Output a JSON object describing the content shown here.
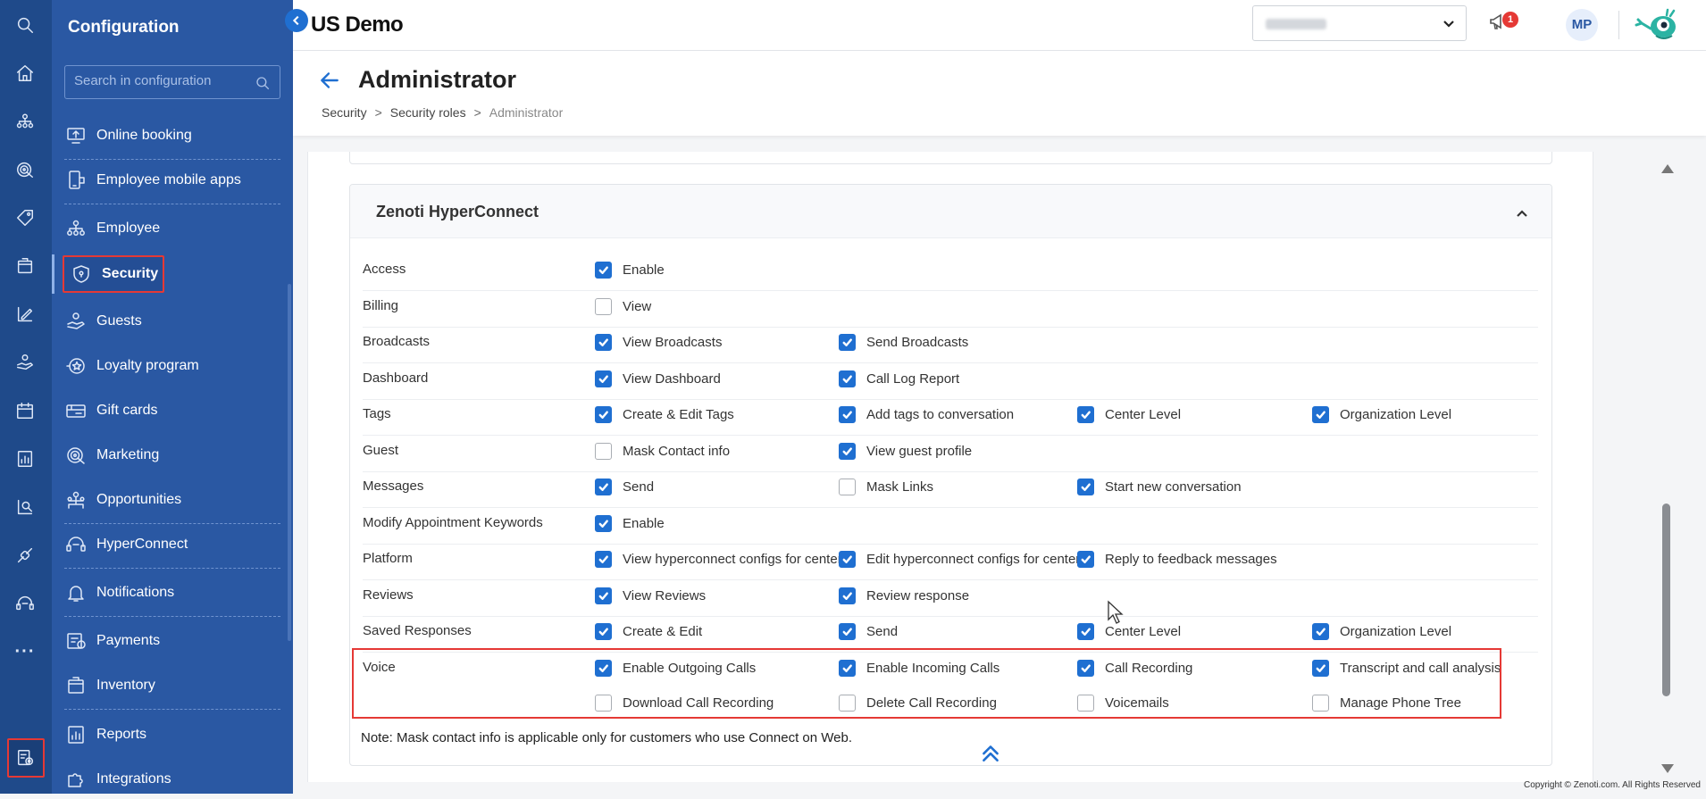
{
  "app": {
    "org_name": "US Demo",
    "avatar_initials": "MP",
    "notification_count": "1"
  },
  "iconbar": {
    "icons": [
      "search-icon",
      "home-icon",
      "org-chart-icon",
      "marketing-target-icon",
      "tag-icon",
      "package-icon",
      "analytics-pencil-icon",
      "guest-hand-icon",
      "calendar-icon",
      "reports-icon",
      "search-people-icon",
      "integrations-icon",
      "headset-icon",
      "more-icon",
      "configuration-icon"
    ]
  },
  "sidebar": {
    "title": "Configuration",
    "search_placeholder": "Search in configuration",
    "items": [
      {
        "label": "Online booking",
        "icon": "monitor-upload-icon"
      },
      {
        "label": "Employee mobile apps",
        "icon": "mobile-app-icon"
      },
      {
        "label": "Employee",
        "icon": "org-chart-icon"
      },
      {
        "label": "Security",
        "icon": "shield-icon"
      },
      {
        "label": "Guests",
        "icon": "guest-hand-icon"
      },
      {
        "label": "Loyalty program",
        "icon": "loyalty-star-icon"
      },
      {
        "label": "Gift cards",
        "icon": "gift-card-icon"
      },
      {
        "label": "Marketing",
        "icon": "marketing-target-icon"
      },
      {
        "label": "Opportunities",
        "icon": "opportunities-icon"
      },
      {
        "label": "HyperConnect",
        "icon": "headset-icon"
      },
      {
        "label": "Notifications",
        "icon": "bell-icon"
      },
      {
        "label": "Payments",
        "icon": "payment-icon"
      },
      {
        "label": "Inventory",
        "icon": "box-icon"
      },
      {
        "label": "Reports",
        "icon": "reports-icon"
      },
      {
        "label": "Integrations",
        "icon": "puzzle-icon"
      }
    ]
  },
  "page": {
    "title": "Administrator",
    "breadcrumb": [
      "Security",
      "Security roles",
      "Administrator"
    ]
  },
  "section": {
    "title": "Zenoti HyperConnect",
    "rows": [
      {
        "label": "Access",
        "perms": [
          {
            "label": "Enable",
            "checked": true
          }
        ]
      },
      {
        "label": "Billing",
        "perms": [
          {
            "label": "View",
            "checked": false
          }
        ]
      },
      {
        "label": "Broadcasts",
        "perms": [
          {
            "label": "View Broadcasts",
            "checked": true
          },
          {
            "label": "Send Broadcasts",
            "checked": true
          }
        ]
      },
      {
        "label": "Dashboard",
        "perms": [
          {
            "label": "View Dashboard",
            "checked": true
          },
          {
            "label": "Call Log Report",
            "checked": true
          }
        ]
      },
      {
        "label": "Tags",
        "perms": [
          {
            "label": "Create & Edit Tags",
            "checked": true
          },
          {
            "label": "Add tags to conversation",
            "checked": true
          },
          {
            "label": "Center Level",
            "checked": true
          },
          {
            "label": "Organization Level",
            "checked": true
          }
        ]
      },
      {
        "label": "Guest",
        "perms": [
          {
            "label": "Mask Contact info",
            "checked": false
          },
          {
            "label": "View guest profile",
            "checked": true
          }
        ]
      },
      {
        "label": "Messages",
        "perms": [
          {
            "label": "Send",
            "checked": true
          },
          {
            "label": "Mask Links",
            "checked": false
          },
          {
            "label": "Start new conversation",
            "checked": true
          }
        ]
      },
      {
        "label": "Modify Appointment Keywords",
        "perms": [
          {
            "label": "Enable",
            "checked": true
          }
        ]
      },
      {
        "label": "Platform",
        "perms": [
          {
            "label": "View hyperconnect configs for center",
            "checked": true
          },
          {
            "label": "Edit hyperconnect configs for center",
            "checked": true
          },
          {
            "label": "Reply to feedback messages",
            "checked": true
          }
        ]
      },
      {
        "label": "Reviews",
        "perms": [
          {
            "label": "View Reviews",
            "checked": true
          },
          {
            "label": "Review response",
            "checked": true
          }
        ]
      },
      {
        "label": "Saved Responses",
        "perms": [
          {
            "label": "Create & Edit",
            "checked": true
          },
          {
            "label": "Send",
            "checked": true
          },
          {
            "label": "Center Level",
            "checked": true
          },
          {
            "label": "Organization Level",
            "checked": true
          }
        ]
      },
      {
        "label": "Voice",
        "perms": [
          {
            "label": "Enable Outgoing Calls",
            "checked": true
          },
          {
            "label": "Enable Incoming Calls",
            "checked": true
          },
          {
            "label": "Call Recording",
            "checked": true
          },
          {
            "label": "Transcript and call analysis",
            "checked": true
          }
        ]
      },
      {
        "label": "",
        "perms": [
          {
            "label": "Download Call Recording",
            "checked": false
          },
          {
            "label": "Delete Call Recording",
            "checked": false
          },
          {
            "label": "Voicemails",
            "checked": false
          },
          {
            "label": "Manage Phone Tree",
            "checked": false
          }
        ]
      }
    ],
    "note": "Note: Mask contact info is applicable only for customers who use Connect on Web."
  },
  "footer": {
    "copyright": "Copyright © Zenoti.com. All Rights Reserved"
  },
  "colors": {
    "sidebar_dark": "#1f4a8a",
    "sidebar": "#2a58a3",
    "accent": "#1f6fd1",
    "highlight_box": "#e53935"
  }
}
